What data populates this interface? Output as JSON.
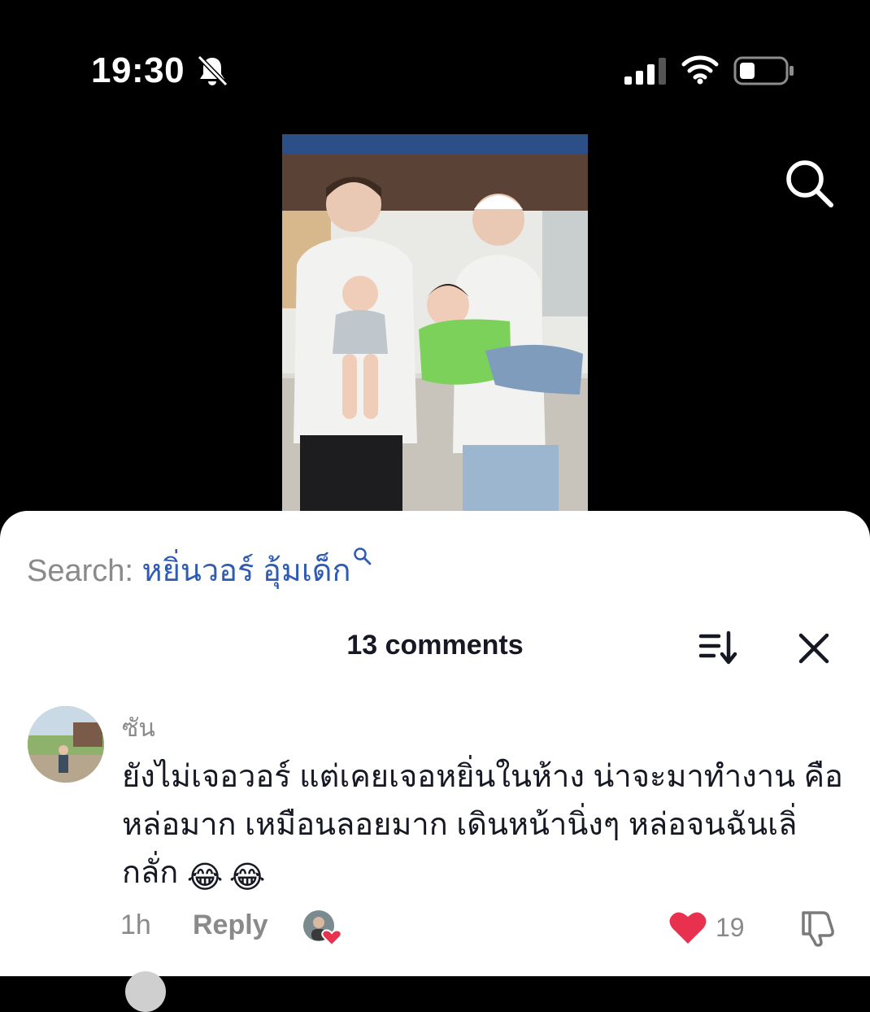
{
  "status_bar": {
    "time": "19:30",
    "icons": [
      "bell-muted-icon",
      "cellular-signal-icon",
      "wifi-icon",
      "battery-low-icon"
    ]
  },
  "top_bar": {
    "search_icon": "search-icon"
  },
  "video": {
    "thumbnail": "video-thumbnail"
  },
  "sheet": {
    "search_prefix": "Search:",
    "search_query": "หยิ่นวอร์ อุ้มเด็ก",
    "comments_count": "13 comments",
    "sort_icon": "sort-icon",
    "close_icon": "close-icon"
  },
  "comment": {
    "username": "ซัน",
    "text": "ยังไม่เจอวอร์ แต่เคยเจอหยิ่นในห้าง น่าจะมาทำงาน คือ\nหล่อมาก เหมือนลอยมาก เดินหน้านิ่งๆ หล่อจนฉันเลิ่\nกลั่ก",
    "emojis": [
      "😂",
      "😂"
    ],
    "time_ago": "1h",
    "reply_label": "Reply",
    "like_count": "19"
  },
  "colors": {
    "background": "#000000",
    "sheet": "#ffffff",
    "search_query": "#2e5bb3",
    "like_red": "#e8314f",
    "muted_text": "#8a8a8a"
  }
}
